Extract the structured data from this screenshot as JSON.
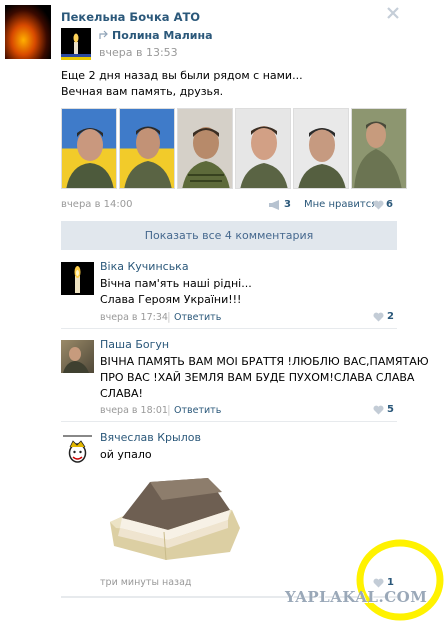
{
  "post": {
    "group_name": "Пекельна Бочка АТО",
    "repost_author": "Полина Малина",
    "repost_time": "вчера в 13:53",
    "text_line1": "Еще 2 дня назад вы были рядом с нами...",
    "text_line2": "Вечная вам память, друзья.",
    "time": "вчера в 14:00",
    "share_count": "3",
    "like_label": "Мне нравится",
    "like_count": "6",
    "show_comments": "Показать все 4 комментария"
  },
  "comments": [
    {
      "author": "Віка Кучинська",
      "line1": "Вічна пам'ять наші рідні...",
      "line2": "Слава Героям України!!!",
      "time": "вчера в 17:34",
      "reply": "Ответить",
      "likes": "2"
    },
    {
      "author": "Паша Богун",
      "line1": "ВІЧНА ПАМЯТЬ ВАМ МОІ БРАТТЯ !ЛЮБЛЮ ВАС,ПАМЯТАЮ",
      "line2": "ПРО ВАС !ХАЙ ЗЕМЛЯ ВАМ БУДЕ ПУХОМ!СЛАВА СЛАВА",
      "line3": "СЛАВА!",
      "time": "вчера в 18:01",
      "reply": "Ответить",
      "likes": "5"
    },
    {
      "author": "Вячеслав Крылов",
      "line1": "ой упало",
      "time": "три минуты назад",
      "likes": "1"
    }
  ],
  "watermark": "YAPLAKAL.COM",
  "colors": {
    "link": "#2B587A",
    "gray": "#999999",
    "button_bg": "#E1E7ED",
    "highlight": "#FFF200"
  },
  "icons": [
    "close-icon",
    "repost-arrow-icon",
    "megaphone-icon",
    "heart-icon"
  ]
}
